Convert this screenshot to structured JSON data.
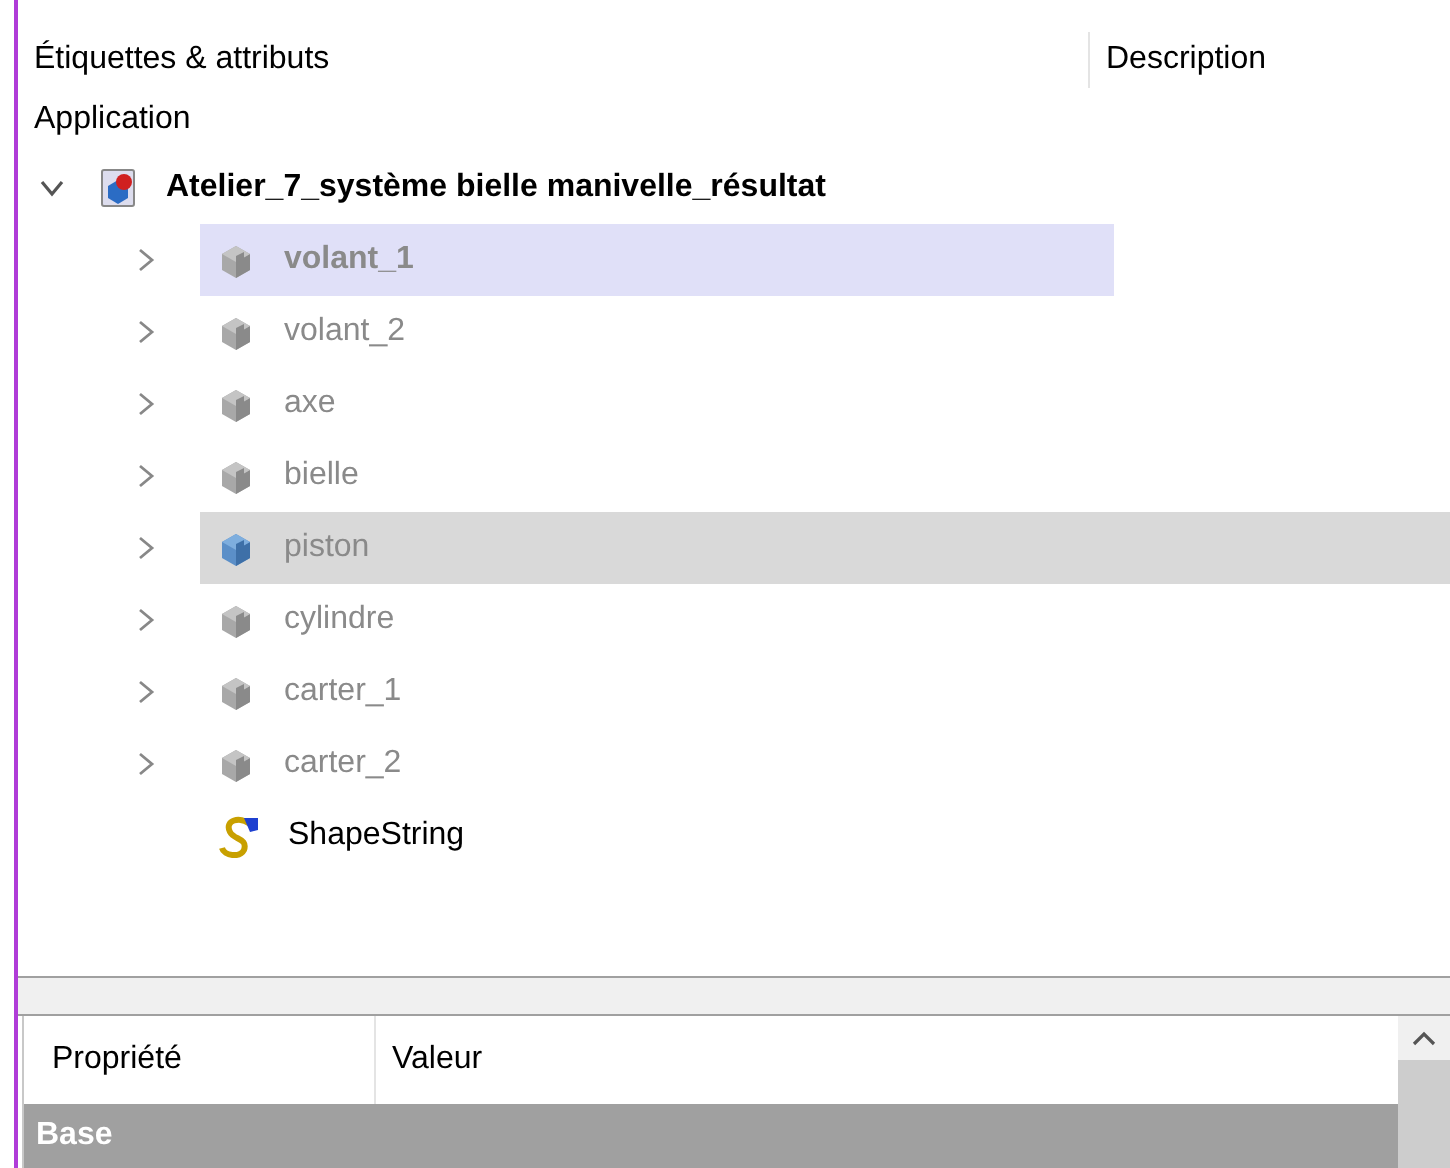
{
  "tree": {
    "columns": [
      "Étiquettes & attributs",
      "Description"
    ],
    "group_label": "Application",
    "root": {
      "label": "Atelier_7_système bielle manivelle_résultat",
      "expanded": true,
      "children": [
        {
          "label": "volant_1",
          "kind": "part",
          "has_children": true,
          "hidden": true,
          "selected": true,
          "highlighted": false
        },
        {
          "label": "volant_2",
          "kind": "part",
          "has_children": true,
          "hidden": true,
          "selected": false,
          "highlighted": false
        },
        {
          "label": "axe",
          "kind": "part",
          "has_children": true,
          "hidden": true,
          "selected": false,
          "highlighted": false
        },
        {
          "label": "bielle",
          "kind": "part",
          "has_children": true,
          "hidden": true,
          "selected": false,
          "highlighted": false
        },
        {
          "label": "piston",
          "kind": "part",
          "has_children": true,
          "hidden": true,
          "selected": false,
          "highlighted": true
        },
        {
          "label": "cylindre",
          "kind": "part",
          "has_children": true,
          "hidden": true,
          "selected": false,
          "highlighted": false
        },
        {
          "label": "carter_1",
          "kind": "part",
          "has_children": true,
          "hidden": true,
          "selected": false,
          "highlighted": false
        },
        {
          "label": "carter_2",
          "kind": "part",
          "has_children": true,
          "hidden": true,
          "selected": false,
          "highlighted": false
        },
        {
          "label": "ShapeString",
          "kind": "shapestring",
          "has_children": false,
          "hidden": false,
          "selected": false,
          "highlighted": false
        }
      ]
    }
  },
  "properties": {
    "columns": [
      "Propriété",
      "Valeur"
    ],
    "groups": [
      "Base"
    ]
  }
}
